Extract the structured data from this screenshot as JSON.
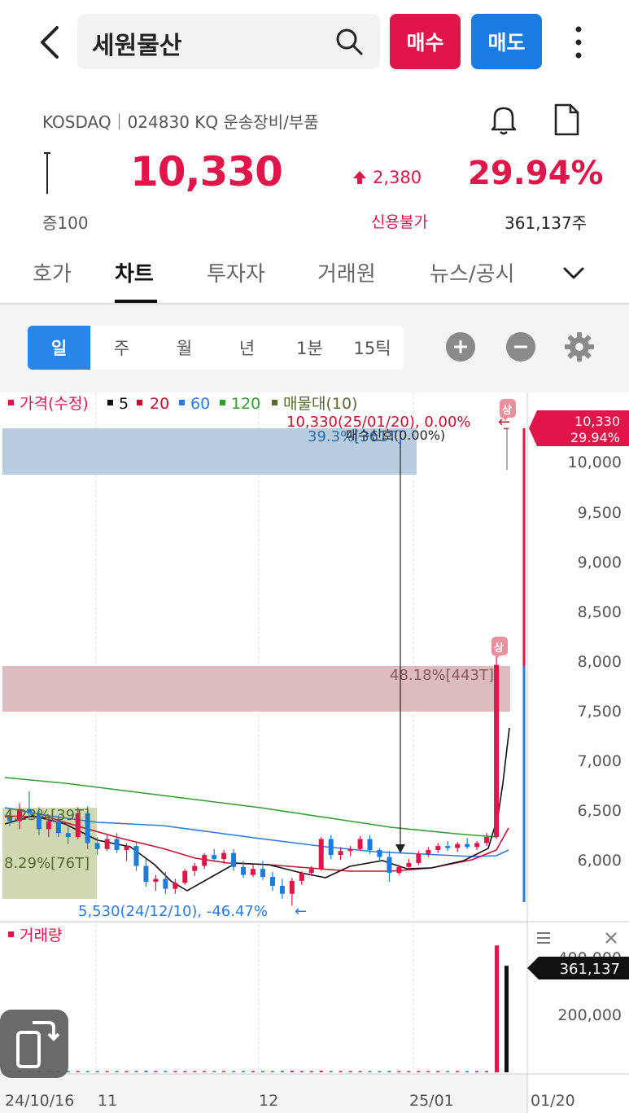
{
  "header": {
    "search_text": "세원물산",
    "buy_label": "매수",
    "sell_label": "매도"
  },
  "stock": {
    "market_line": "KOSDAQ｜024830 KQ 운송장비/부품",
    "price": "10,330",
    "change": "2,380",
    "change_pct": "29.94%",
    "jeung": "증100",
    "credit": "신용불가",
    "volume": "361,137주"
  },
  "tabs": [
    "호가",
    "차트",
    "투자자",
    "거래원",
    "뉴스/공시"
  ],
  "periods": [
    "일",
    "주",
    "월",
    "년",
    "1분",
    "15틱"
  ],
  "legend": {
    "price": "가격(수정)",
    "ma5": "5",
    "ma20": "20",
    "ma60": "60",
    "ma120": "120",
    "profile": "매물대(10)"
  },
  "annotations": {
    "high": "10,330(25/01/20), 0.00%",
    "low": "5,530(24/12/10), -46.47%",
    "up_limit": "상",
    "profile_top": "39.3%[361T]",
    "profile_overlay": "매수신호(0.00%)",
    "profile_mid": "48.18%[443T]",
    "profile_low1": "4.23%[39T]",
    "profile_low2": "8.29%[76T]",
    "volume_title": "거래량"
  },
  "axis": {
    "price_ticks": [
      "10,000",
      "9,500",
      "9,000",
      "8,500",
      "8,000",
      "7,500",
      "7,000",
      "6,500",
      "6,000"
    ],
    "volume_ticks": [
      "400,000",
      "200,000"
    ],
    "date_ticks": [
      "24/10/16",
      "11",
      "12",
      "25/01",
      "01/20"
    ],
    "price_badge_1": "10,330",
    "price_badge_2": "29.94%",
    "volume_badge": "361,137"
  },
  "colors": {
    "up": "#e0164b",
    "down": "#1a7be0",
    "ma5": "#111111",
    "ma20": "#c8102e",
    "ma60": "#2a7be0",
    "ma120": "#2ea02e",
    "profile_blue": "#b9cde0",
    "profile_red": "#ddbcc0",
    "profile_green": "#cfd8b0"
  },
  "chart_data": {
    "type": "candlestick",
    "ylim": [
      5500,
      10500
    ],
    "candles": [
      [
        6420,
        6490,
        6330,
        6380
      ],
      [
        6380,
        6560,
        6300,
        6500
      ],
      [
        6500,
        6680,
        6420,
        6460
      ],
      [
        6460,
        6520,
        6240,
        6300
      ],
      [
        6300,
        6440,
        6220,
        6380
      ],
      [
        6380,
        6440,
        6220,
        6260
      ],
      [
        6260,
        6320,
        6150,
        6220
      ],
      [
        6220,
        6520,
        6200,
        6460
      ],
      [
        6460,
        6530,
        6100,
        6160
      ],
      [
        6160,
        6220,
        6040,
        6100
      ],
      [
        6100,
        6250,
        6080,
        6200
      ],
      [
        6200,
        6260,
        6060,
        6090
      ],
      [
        6090,
        6160,
        5980,
        6130
      ],
      [
        6130,
        6170,
        5880,
        5930
      ],
      [
        5930,
        6000,
        5720,
        5770
      ],
      [
        5770,
        5840,
        5680,
        5800
      ],
      [
        5800,
        5870,
        5650,
        5700
      ],
      [
        5700,
        5800,
        5650,
        5760
      ],
      [
        5760,
        5900,
        5740,
        5880
      ],
      [
        5880,
        5960,
        5830,
        5930
      ],
      [
        5930,
        6060,
        5900,
        6040
      ],
      [
        6040,
        6100,
        5970,
        6000
      ],
      [
        6000,
        6090,
        5950,
        6060
      ],
      [
        6060,
        6100,
        5880,
        5920
      ],
      [
        5920,
        5980,
        5810,
        5840
      ],
      [
        5840,
        5940,
        5820,
        5900
      ],
      [
        5900,
        5980,
        5790,
        5820
      ],
      [
        5820,
        5870,
        5680,
        5730
      ],
      [
        5730,
        5800,
        5600,
        5650
      ],
      [
        5650,
        5810,
        5530,
        5780
      ],
      [
        5780,
        5880,
        5740,
        5860
      ],
      [
        5860,
        5930,
        5830,
        5900
      ],
      [
        5900,
        6220,
        5880,
        6200
      ],
      [
        6200,
        6240,
        6000,
        6040
      ],
      [
        6040,
        6120,
        5990,
        6080
      ],
      [
        6080,
        6130,
        6030,
        6100
      ],
      [
        6100,
        6230,
        6080,
        6200
      ],
      [
        6200,
        6240,
        6050,
        6090
      ],
      [
        6090,
        6110,
        5990,
        6020
      ],
      [
        6020,
        6080,
        5770,
        5860
      ],
      [
        5860,
        5940,
        5840,
        5920
      ],
      [
        5920,
        6000,
        5890,
        5960
      ],
      [
        5960,
        6080,
        5940,
        6050
      ],
      [
        6050,
        6120,
        6020,
        6090
      ],
      [
        6090,
        6160,
        6060,
        6130
      ],
      [
        6130,
        6180,
        6080,
        6110
      ],
      [
        6110,
        6170,
        6070,
        6150
      ],
      [
        6150,
        6210,
        6100,
        6120
      ],
      [
        6120,
        6180,
        6090,
        6160
      ],
      [
        6160,
        6260,
        6130,
        6220
      ],
      [
        6220,
        8050,
        6200,
        7950
      ],
      [
        10330,
        10330,
        10330,
        10330
      ]
    ],
    "volume": [
      4000,
      3500,
      3000,
      3800,
      3200,
      2900,
      3100,
      4200,
      3600,
      3300,
      3100,
      3000,
      3200,
      4500,
      5200,
      3900,
      3600,
      3400,
      3600,
      3700,
      4100,
      3500,
      3300,
      3600,
      3900,
      3400,
      3500,
      4200,
      4800,
      5300,
      3900,
      3600,
      5600,
      4300,
      3800,
      3500,
      4100,
      3900,
      3600,
      4600,
      3700,
      3500,
      3800,
      3600,
      3500,
      3400,
      3600,
      3400,
      3500,
      3900,
      430000,
      361137
    ]
  }
}
